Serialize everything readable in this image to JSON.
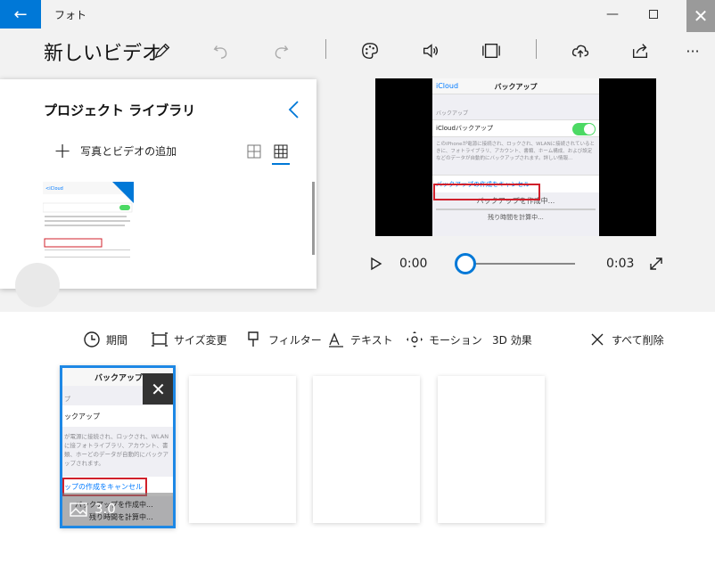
{
  "window": {
    "app_name": "フォト",
    "back_glyph": "←",
    "min_glyph": "—",
    "close_glyph": "✕"
  },
  "toolbar": {
    "project_title": "新しいビデオ",
    "more_glyph": "···"
  },
  "library": {
    "title": "プロジェクト ライブラリ",
    "add_media_label": "写真とビデオの追加",
    "add_glyph": "+"
  },
  "preview": {
    "nav_back": "iCloud",
    "nav_title": "バックアップ",
    "section_header": "バックアップ",
    "toggle_label": "iCloudバックアップ",
    "description": "このiPhoneが電源に接続され、ロックされ、WLANに接続されているときに、フォトライブラリ、アカウント、書類、ホーム構成、および設定などのデータが自動的にバックアップされます。詳しい情報...",
    "cancel_label": "バックアップの作成をキャンセル",
    "progress_label": "バックアップを作成中...",
    "remaining_label": "残り時間を計算中..."
  },
  "playback": {
    "current_time": "0:00",
    "total_time": "0:03",
    "progress": 0
  },
  "storyboard": {
    "tools": [
      {
        "label": "期間",
        "icon": "clock-icon"
      },
      {
        "label": "サイズ変更",
        "icon": "resize-icon"
      },
      {
        "label": "フィルター",
        "icon": "paint-brush-icon"
      },
      {
        "label": "テキスト",
        "icon": "text-icon"
      },
      {
        "label": "モーション",
        "icon": "motion-icon"
      },
      {
        "label": "3D 効果",
        "icon": ""
      },
      {
        "label": "すべて削除",
        "icon": "close-icon"
      }
    ],
    "selected_card": {
      "header": "バックアップ",
      "section": "プ",
      "row_label": "ックアップ",
      "description": "が電源に接続され、ロックされ、WLANに接フォトライブラリ、アカウント、書類、ホーどのデータが自動的にバックアップされます。",
      "cancel_label": "ップの作成をキャンセル",
      "progress_label": "バックアップを作成中...",
      "remaining_label": "残り時間を計算中...",
      "duration": "3.0",
      "close_glyph": "✕"
    }
  },
  "colors": {
    "accent": "#0078d7",
    "highlight_red": "#d0202b",
    "ios_green": "#4cd964",
    "ios_blue": "#007aff"
  }
}
